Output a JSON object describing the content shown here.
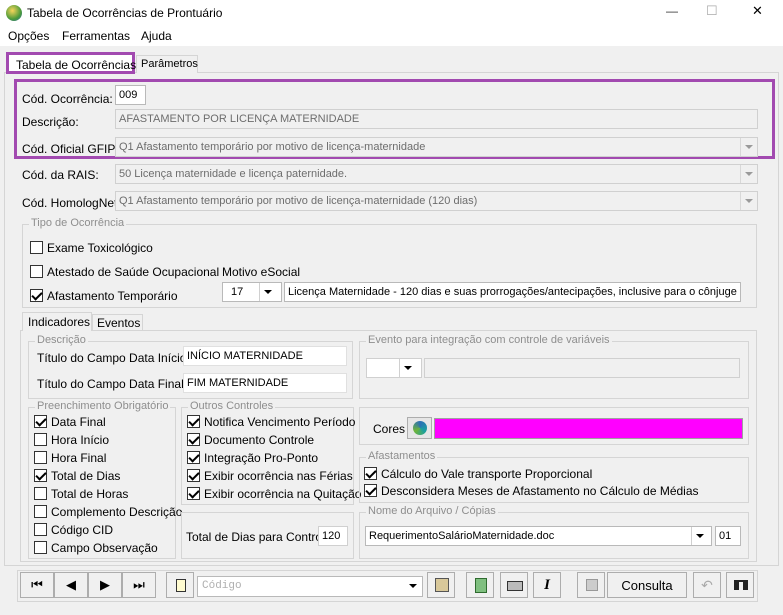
{
  "window": {
    "title": "Tabela de Ocorrências de Prontuário",
    "minimize": "—",
    "maximize": "☐",
    "close": "✕"
  },
  "menu": [
    {
      "label": "Opções"
    },
    {
      "label": "Ferramentas"
    },
    {
      "label": "Ajuda"
    }
  ],
  "tabs": [
    {
      "label": "Tabela de Ocorrências",
      "active": true
    },
    {
      "label": "Parâmetros",
      "active": false
    }
  ],
  "form": {
    "cod_ocorrencia_label": "Cód. Ocorrência:",
    "cod_ocorrencia": "009",
    "descricao_label": "Descrição:",
    "descricao": "AFASTAMENTO POR LICENÇA MATERNIDADE",
    "gfip_label": "Cód. Oficial GFIP:",
    "gfip": "Q1 Afastamento temporário por motivo de licença-maternidade",
    "rais_label": "Cód. da RAIS:",
    "rais": "50 Licença maternidade e licença paternidade.",
    "homolog_label": "Cód. HomologNet:",
    "homolog": "Q1  Afastamento temporário por motivo de licença-maternidade (120 dias)"
  },
  "tipo": {
    "title": "Tipo de Ocorrência",
    "items": [
      {
        "label": "Exame Toxicológico",
        "checked": false
      },
      {
        "label": "Atestado de Saúde Ocupacional",
        "checked": false
      },
      {
        "label": "Afastamento Temporário",
        "checked": true
      }
    ],
    "motivo_label": "Motivo eSocial",
    "motivo_code": "17",
    "motivo_desc": "Licença Maternidade - 120 dias e suas prorrogações/antecipações, inclusive para o cônjuge sobrevivente"
  },
  "subtabs": [
    {
      "label": "Indicadores",
      "active": true
    },
    {
      "label": "Eventos",
      "active": false
    }
  ],
  "descricao_group": {
    "title": "Descrição",
    "inicio_label": "Título do Campo Data Início:",
    "inicio": "INÍCIO MATERNIDADE",
    "final_label": "Título do Campo Data Final:",
    "final": "FIM MATERNIDADE"
  },
  "evento_group": {
    "title": "Evento para integração com controle de variáveis"
  },
  "preenchimento": {
    "title": "Preenchimento Obrigatório",
    "items": [
      {
        "label": "Data Final",
        "checked": true
      },
      {
        "label": "Hora Início",
        "checked": false
      },
      {
        "label": "Hora Final",
        "checked": false
      },
      {
        "label": "Total de Dias",
        "checked": true
      },
      {
        "label": "Total de Horas",
        "checked": false
      },
      {
        "label": "Complemento Descrição",
        "checked": false
      },
      {
        "label": "Código CID",
        "checked": false
      },
      {
        "label": "Campo Observação",
        "checked": false
      }
    ]
  },
  "outros": {
    "title": "Outros Controles",
    "items": [
      {
        "label": "Notifica Vencimento Período",
        "checked": true
      },
      {
        "label": "Documento Controle",
        "checked": true
      },
      {
        "label": "Integração Pro-Ponto",
        "checked": true
      },
      {
        "label": "Exibir ocorrência nas Férias",
        "checked": true
      },
      {
        "label": "Exibir ocorrência na Quitação",
        "checked": true
      }
    ],
    "total_label": "Total de Dias para Controle:",
    "total": "120"
  },
  "cores": {
    "label": "Cores",
    "color": "#ff00ff"
  },
  "afastamentos": {
    "title": "Afastamentos",
    "items": [
      {
        "label": "Cálculo do Vale transporte Proporcional",
        "checked": true
      },
      {
        "label": "Desconsidera Meses de Afastamento no Cálculo de Médias",
        "checked": true
      }
    ]
  },
  "arquivo": {
    "title": "Nome do Arquivo / Cópias",
    "file": "RequerimentoSalárioMaternidade.doc",
    "copies": "01"
  },
  "toolbar": {
    "codigo_placeholder": "Código",
    "consulta_label": "Consulta",
    "first": "⏮",
    "prev": "◀",
    "next": "▶",
    "last": "⏭"
  },
  "colors": {
    "highlight": "#a24ab0",
    "accent": "#ff00ff"
  }
}
